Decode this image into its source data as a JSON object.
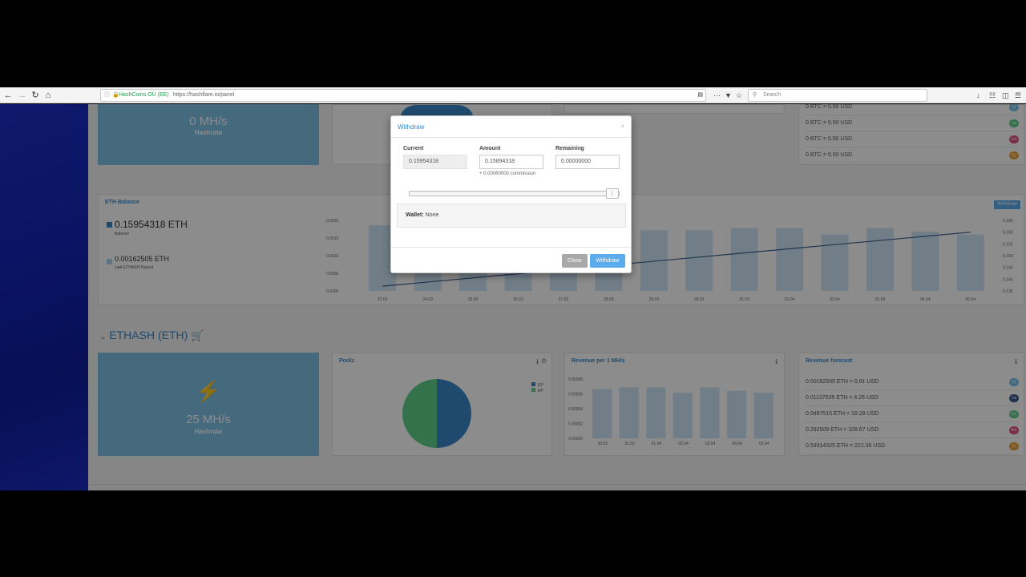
{
  "browser": {
    "secure_label": "HashCoins OÜ (EE)",
    "url": "https://hashflare.io/panel",
    "search_placeholder": "Search"
  },
  "top_section": {
    "hashrate_value": "0 MH/s",
    "hashrate_label": "Hashrate",
    "btc_forecast": [
      {
        "text": "0 BTC = 0.00 USD",
        "badge": "1d",
        "color": "#7fc1e6"
      },
      {
        "text": "0 BTC = 0.00 USD",
        "badge": "1w",
        "color": "#5fd08a"
      },
      {
        "text": "0 BTC = 0.00 USD",
        "badge": "1m",
        "color": "#e0527a"
      },
      {
        "text": "0 BTC = 0.00 USD",
        "badge": "1y",
        "color": "#e8a53c"
      }
    ]
  },
  "eth_balance": {
    "title": "ETH Balance",
    "withdraw_label": "Withdraw",
    "balance_value": "0.15954318 ETH",
    "balance_label": "Balance",
    "payout_value": "0.00162505 ETH",
    "payout_label": "Last ETHASH Payout",
    "chart": {
      "x_labels": [
        "23.03",
        "24.03",
        "25.03",
        "26.03",
        "27.03",
        "28.03",
        "29.03",
        "30.03",
        "31.03",
        "01.04",
        "02.04",
        "03.04",
        "04.04",
        "05.04"
      ],
      "left_ticks": [
        "0.0020",
        "0.0015",
        "0.0010",
        "0.0005",
        "0.0000"
      ],
      "right_ticks": [
        "0.165",
        "0.160",
        "0.155",
        "0.150",
        "0.145",
        "0.140",
        "0.135"
      ],
      "bars_fraction": [
        0.93,
        0.86,
        0.84,
        0.86,
        0.86,
        0.86,
        0.86,
        0.86,
        0.89,
        0.89,
        0.8,
        0.89,
        0.84,
        0.8
      ],
      "line_start": [
        0,
        0.137
      ],
      "line_end": [
        13,
        0.16
      ]
    }
  },
  "ethash_section": {
    "title": "ETHASH (ETH)",
    "hashrate_value": "25 MH/s",
    "hashrate_label": "Hashrate",
    "pools_title": "Pools",
    "pools_legend": [
      "EP",
      "EP"
    ],
    "revenue_title": "Revenue per 1 MH/s",
    "revenue_ticks": [
      "0.00008",
      "0.00006",
      "0.00004",
      "0.00002",
      "0.00000"
    ],
    "revenue_x": [
      "30.03",
      "31.03",
      "01.04",
      "02.04",
      "03.04",
      "04.04",
      "05.04"
    ],
    "revenue_bars": [
      0.83,
      0.86,
      0.86,
      0.77,
      0.86,
      0.8,
      0.77
    ],
    "forecast_title": "Revenue forecast",
    "forecast": [
      {
        "text": "0.00162505 ETH = 0.61 USD",
        "badge": "1d",
        "color": "#7fc1e6"
      },
      {
        "text": "0.01137535 ETH = 4.26 USD",
        "badge": "1w",
        "color": "#3a5a8a"
      },
      {
        "text": "0.0487515 ETH = 18.28 USD",
        "badge": "1m",
        "color": "#5fd08a"
      },
      {
        "text": "0.292509 ETH = 109.67 USD",
        "badge": "6m",
        "color": "#e0527a"
      },
      {
        "text": "0.59314325 ETH = 222.38 USD",
        "badge": "1y",
        "color": "#e8a53c"
      }
    ]
  },
  "modal": {
    "title": "Withdraw",
    "close_x": "×",
    "current_label": "Current",
    "current_value": "0.15954318",
    "amount_label": "Amount",
    "amount_value": "0.15894318",
    "commission": "+ 0.00060000 commission",
    "remaining_label": "Remaining",
    "remaining_value": "0.00000000",
    "slider_fraction": 0.996,
    "wallet_label": "Wallet:",
    "wallet_value": "None",
    "close_button": "Close",
    "withdraw_button": "Withdraw"
  }
}
